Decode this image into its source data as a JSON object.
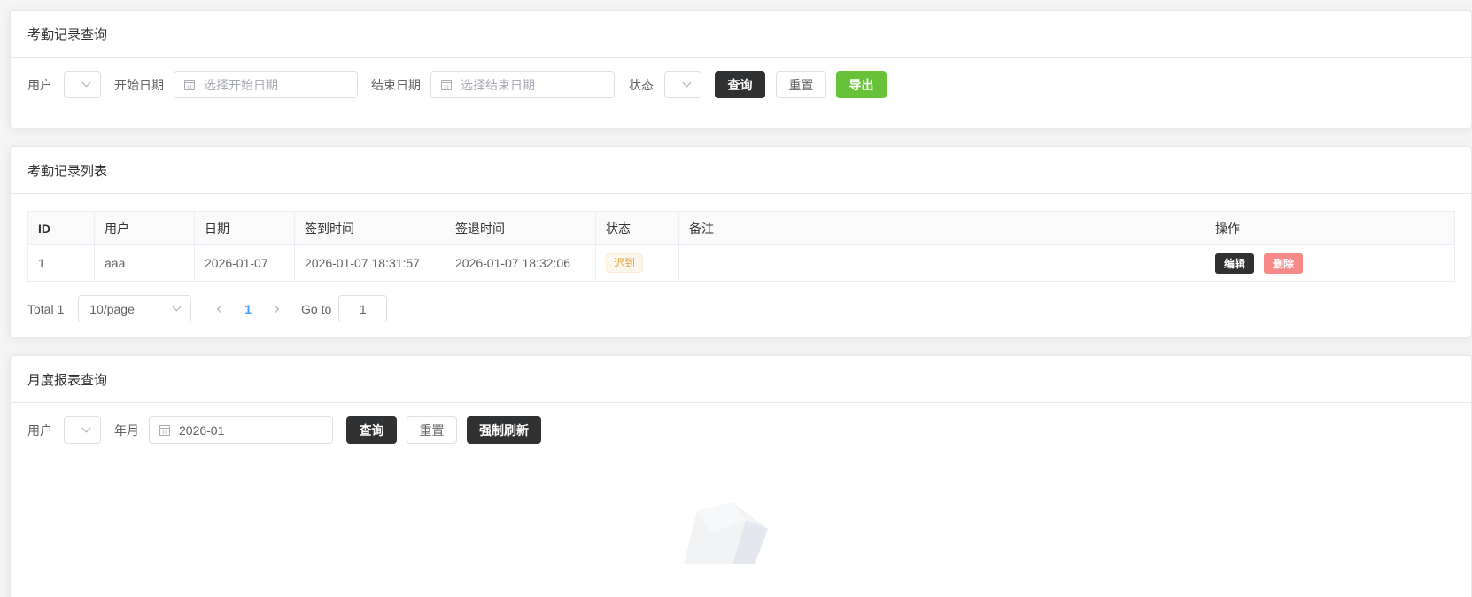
{
  "query": {
    "title": "考勤记录查询",
    "user_label": "用户",
    "start_label": "开始日期",
    "start_placeholder": "选择开始日期",
    "end_label": "结束日期",
    "end_placeholder": "选择结束日期",
    "status_label": "状态",
    "search_btn": "查询",
    "reset_btn": "重置",
    "export_btn": "导出"
  },
  "list": {
    "title": "考勤记录列表",
    "columns": [
      "ID",
      "用户",
      "日期",
      "签到时间",
      "签退时间",
      "状态",
      "备注",
      "操作"
    ],
    "rows": [
      {
        "id": "1",
        "user": "aaa",
        "date": "2026-01-07",
        "checkin": "2026-01-07 18:31:57",
        "checkout": "2026-01-07 18:32:06",
        "status": "迟到",
        "remark": "",
        "edit": "编辑",
        "delete": "删除"
      }
    ],
    "pager": {
      "total": "Total 1",
      "page_size": "10/page",
      "current": "1",
      "goto_label": "Go to",
      "goto_value": "1"
    }
  },
  "monthly": {
    "title": "月度报表查询",
    "user_label": "用户",
    "month_label": "年月",
    "month_value": "2026-01",
    "search_btn": "查询",
    "reset_btn": "重置",
    "refresh_btn": "强制刷新"
  },
  "colors": {
    "primary_dark": "#303133",
    "export_green": "#67c23a",
    "delete_red": "#f78989",
    "page_active": "#409eff",
    "tag_warning": "#e6a23c"
  }
}
